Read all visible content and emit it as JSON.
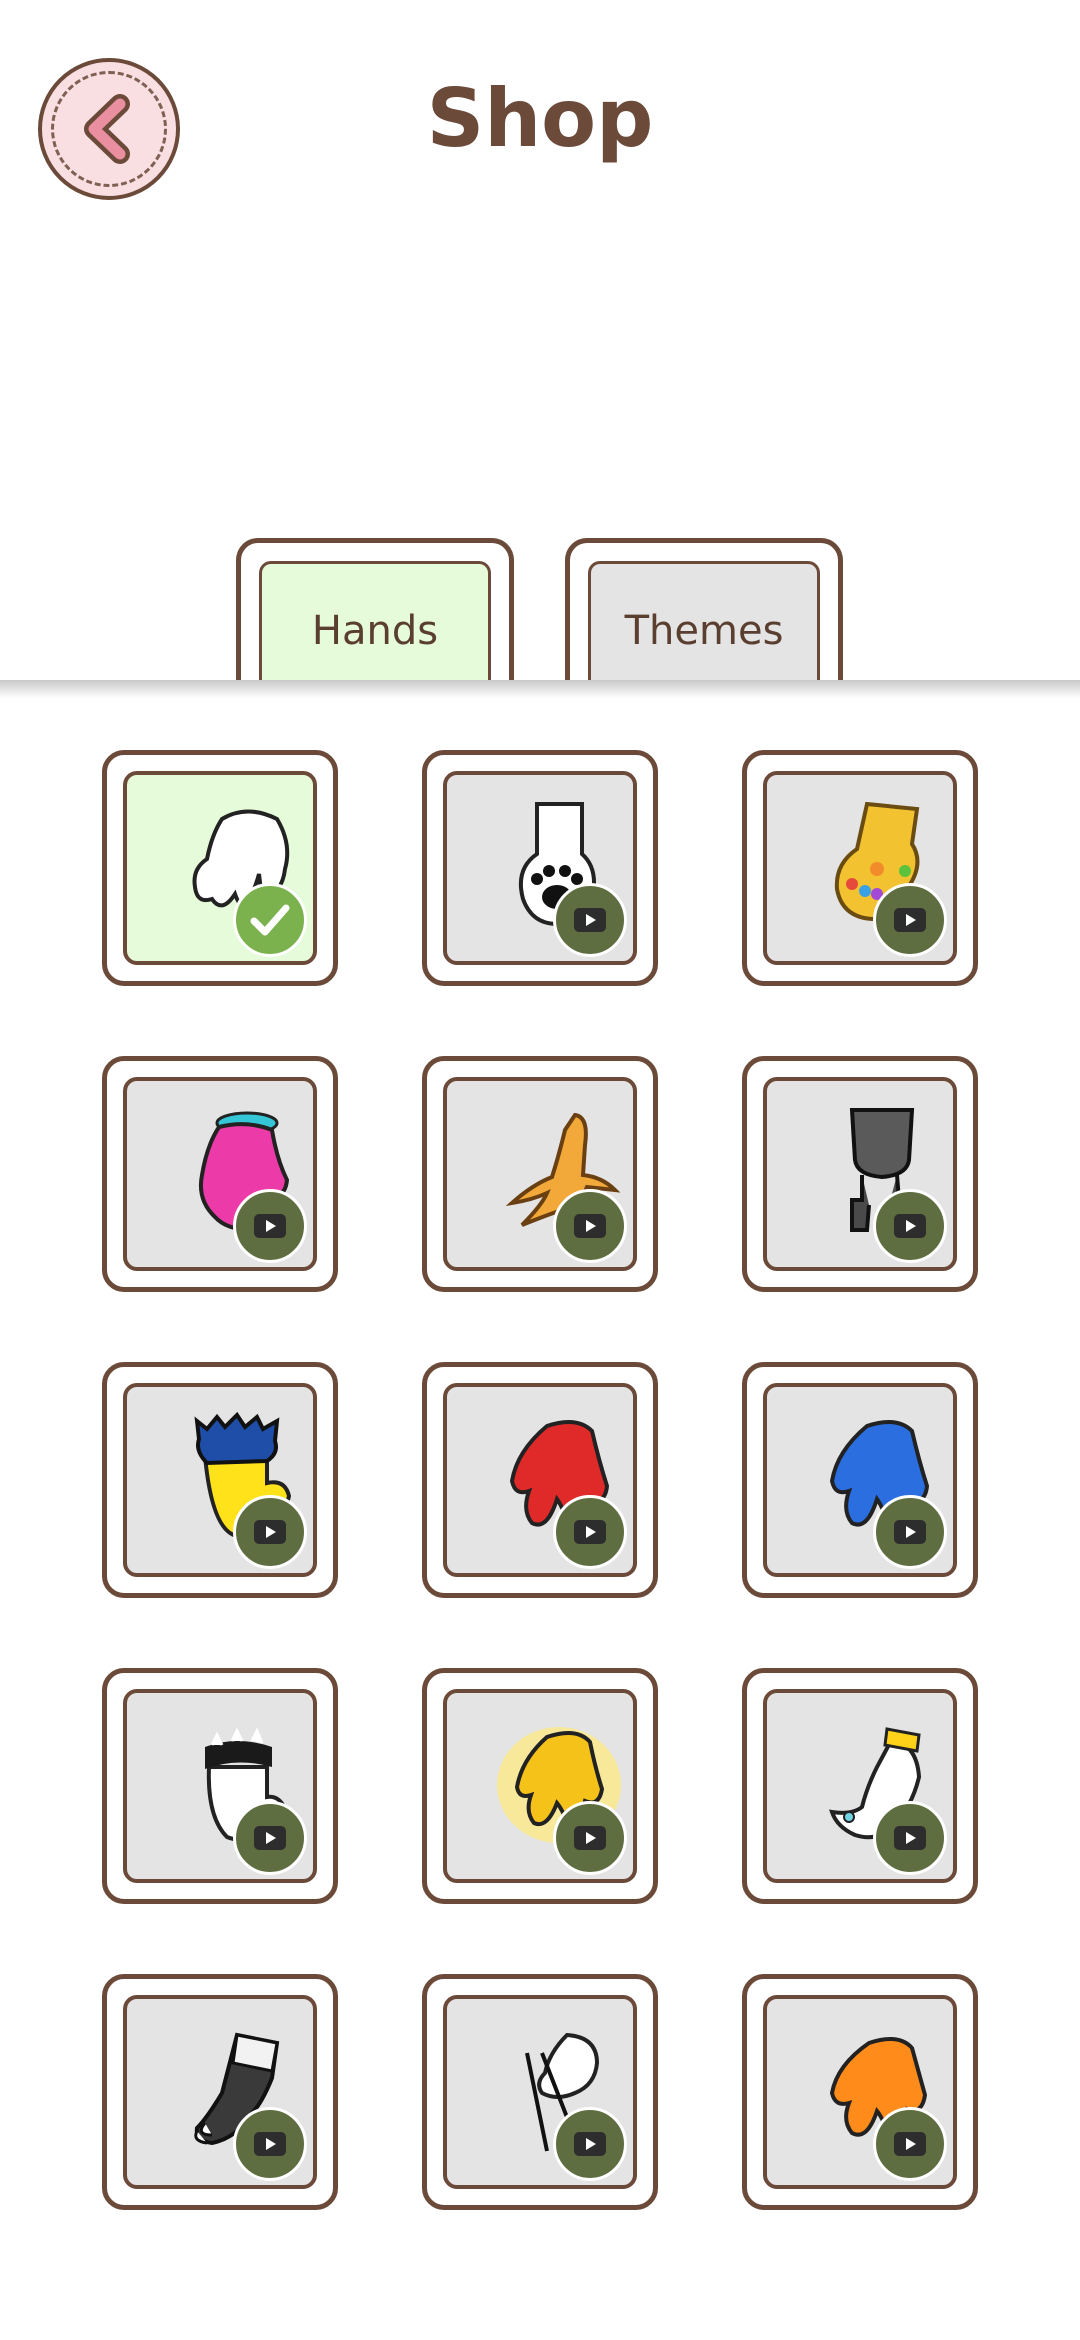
{
  "header": {
    "title": "Shop"
  },
  "tabs": [
    {
      "label": "Hands",
      "selected": true
    },
    {
      "label": "Themes",
      "selected": false
    }
  ],
  "colors": {
    "brown": "#6b4a3a",
    "selected_bg": "#e6fbd9",
    "item_bg": "#e4e4e4",
    "video_badge": "#5f6e41",
    "check_badge": "#7bb24d"
  },
  "items": [
    {
      "icon": "white-glove-icon",
      "status": "selected"
    },
    {
      "icon": "cat-paw-icon",
      "status": "watch-ad"
    },
    {
      "icon": "golden-gauntlet-icon",
      "status": "watch-ad"
    },
    {
      "icon": "pink-hand-icon",
      "status": "watch-ad"
    },
    {
      "icon": "bird-claw-icon",
      "status": "watch-ad"
    },
    {
      "icon": "robot-claw-icon",
      "status": "watch-ad"
    },
    {
      "icon": "yellow-fur-mitten-icon",
      "status": "watch-ad"
    },
    {
      "icon": "red-hand-icon",
      "status": "watch-ad"
    },
    {
      "icon": "blue-hand-icon",
      "status": "watch-ad"
    },
    {
      "icon": "spiked-bracelet-hand-icon",
      "status": "watch-ad"
    },
    {
      "icon": "glowing-gold-hand-icon",
      "status": "watch-ad"
    },
    {
      "icon": "ring-hand-icon",
      "status": "watch-ad"
    },
    {
      "icon": "fingerless-glove-icon",
      "status": "watch-ad"
    },
    {
      "icon": "chopsticks-hand-icon",
      "status": "watch-ad"
    },
    {
      "icon": "orange-hand-icon",
      "status": "watch-ad"
    }
  ]
}
